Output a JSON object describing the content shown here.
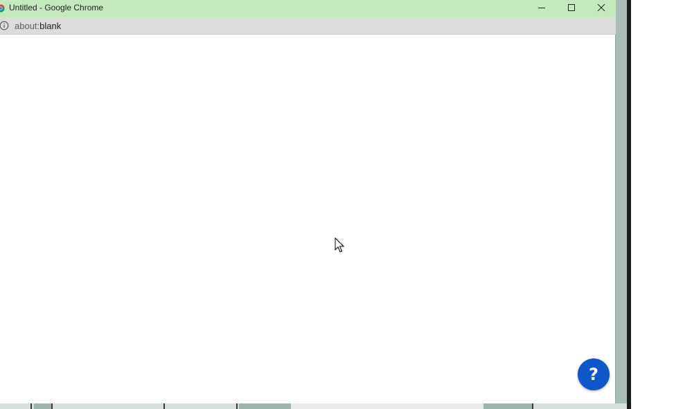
{
  "window": {
    "title": "Untitled - Google Chrome",
    "controls": {
      "minimize_icon": "minimize-icon",
      "maximize_icon": "maximize-icon",
      "close_icon": "close-icon"
    },
    "titlebar_color": "#c6e8bf"
  },
  "addressbar": {
    "info_icon": "info-icon",
    "url_scheme": "about:",
    "url_rest": "blank"
  },
  "help": {
    "label": "?",
    "color": "#0f57c8"
  }
}
